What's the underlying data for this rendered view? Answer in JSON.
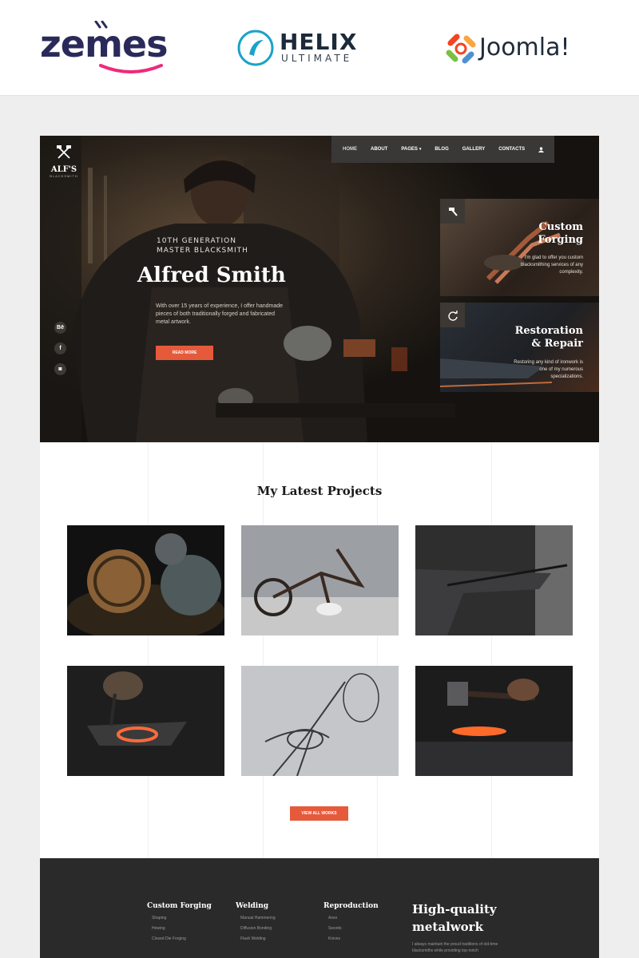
{
  "brands": {
    "zemes": "zemes",
    "helix_main": "HELIX",
    "helix_sub": "ULTIMATE",
    "joomla": "Joomla!",
    "joomla_mark": "®"
  },
  "site": {
    "logo_name": "ALF'S",
    "logo_sub": "BLACKSMITH"
  },
  "nav": {
    "items": [
      {
        "label": "HOME",
        "active": true
      },
      {
        "label": "ABOUT"
      },
      {
        "label": "PAGES",
        "caret": "▾"
      },
      {
        "label": "BLOG"
      },
      {
        "label": "GALLERY"
      },
      {
        "label": "CONTACTS"
      }
    ],
    "user_icon": "user-icon"
  },
  "hero": {
    "eyebrow_line1": "10TH GENERATION",
    "eyebrow_line2": "MASTER BLACKSMITH",
    "title": "Alfred Smith",
    "text": "With over 15 years of experience, I offer handmade pieces of both traditionally forged and fabricated metal artwork.",
    "button": "READ MORE",
    "social": [
      "Bē",
      "f",
      "◙"
    ]
  },
  "cards": [
    {
      "title_line1": "Custom",
      "title_line2": "Forging",
      "text": "I'm glad to offer you custom blacksmithing services of any complexity.",
      "icon": "hammer-icon"
    },
    {
      "title_line1": "Restoration",
      "title_line2": "& Repair",
      "text": "Restoring any kind of ironwork is one of my numerous specializations.",
      "icon": "refresh-icon"
    }
  ],
  "projects": {
    "title": "My Latest Projects",
    "button": "VIEW ALL WORKS"
  },
  "footer": {
    "columns": [
      {
        "heading": "Custom Forging",
        "links": [
          "Shaping",
          "Hewing",
          "Closed Die Forging"
        ]
      },
      {
        "heading": "Welding",
        "links": [
          "Manual Hammering",
          "Diffusion Bonding",
          "Flash Welding"
        ]
      },
      {
        "heading": "Reproduction",
        "links": [
          "Axes",
          "Swords",
          "Knives"
        ]
      }
    ],
    "big_line1": "High-quality",
    "big_line2": "metalwork",
    "text": "I always maintain the proud traditions of old-time blacksmiths while providing top-notch"
  },
  "colors": {
    "accent": "#e65a3c",
    "dark": "#2a2a2a",
    "nav": "#3a3836"
  }
}
